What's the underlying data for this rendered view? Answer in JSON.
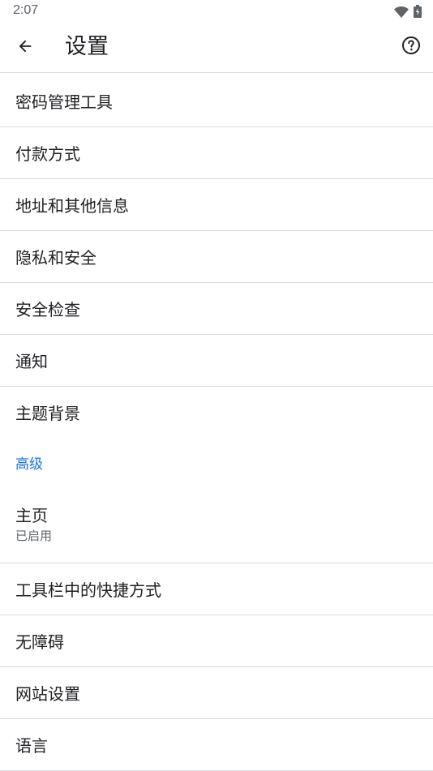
{
  "status_bar": {
    "time": "2:07",
    "icons": [
      "wifi-icon",
      "battery-icon"
    ]
  },
  "toolbar": {
    "title": "设置",
    "back_icon": "arrow-back-icon",
    "help_icon": "help-circle-icon"
  },
  "items_top": [
    {
      "label": "密码管理工具"
    },
    {
      "label": "付款方式"
    },
    {
      "label": "地址和其他信息"
    },
    {
      "label": "隐私和安全"
    },
    {
      "label": "安全检查"
    },
    {
      "label": "通知"
    },
    {
      "label": "主题背景"
    }
  ],
  "section_advanced": "高级",
  "homepage": {
    "label": "主页",
    "summary": "已启用"
  },
  "items_bottom": [
    {
      "label": "工具栏中的快捷方式"
    },
    {
      "label": "无障碍"
    },
    {
      "label": "网站设置"
    },
    {
      "label": "语言"
    }
  ],
  "colors": {
    "accent": "#1a73e8",
    "text_primary": "#202124",
    "text_secondary": "#5f6368",
    "divider": "#dadce0"
  }
}
